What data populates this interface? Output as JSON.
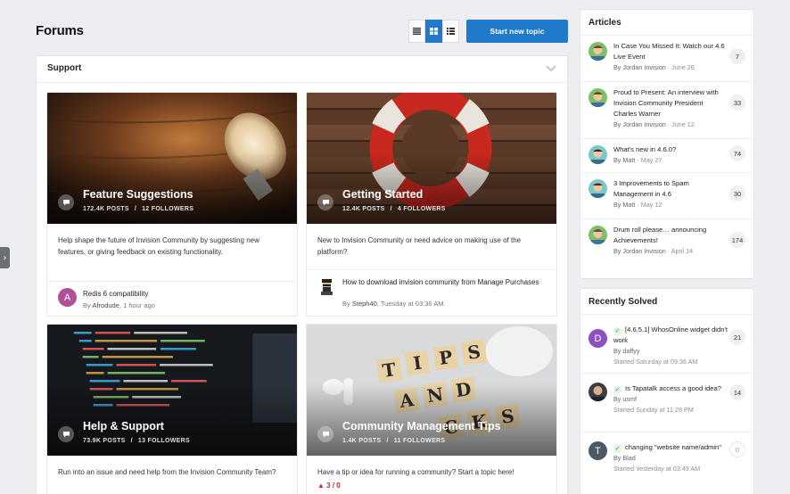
{
  "page": {
    "title": "Forums"
  },
  "toolbar": {
    "start_topic_label": "Start new topic"
  },
  "view_modes": [
    {
      "name": "list-view",
      "icon": "list-icon",
      "active": false
    },
    {
      "name": "grid-view",
      "icon": "grid-icon",
      "active": true
    },
    {
      "name": "table-view",
      "icon": "table-icon",
      "active": false
    }
  ],
  "category": {
    "title": "Support"
  },
  "forums": [
    {
      "title": "Feature Suggestions",
      "posts": "172.4K POSTS",
      "followers": "12 FOLLOWERS",
      "description": "Help shape the future of Invision Community by suggesting new features, or giving feedback on existing functionality.",
      "last_post": {
        "title": "Redis 6 compatibility",
        "by": "By",
        "author": "Afrodude",
        "time": "1 hour ago",
        "avatar_letter": "A",
        "avatar_color": "#b24f9b"
      }
    },
    {
      "title": "Getting Started",
      "posts": "12.4K POSTS",
      "followers": "4 FOLLOWERS",
      "description": "New to Invision Community or need advice on making use of the platform?",
      "last_post": {
        "title": "How to download invision community from Manage Purchases",
        "by": "By",
        "author": "Steph40",
        "time": "Tuesday at 03:36 AM"
      }
    },
    {
      "title": "Help & Support",
      "posts": "73.9K POSTS",
      "followers": "13 FOLLOWERS",
      "description": "Run into an issue and need help from the Invision Community Team?"
    },
    {
      "title": "Community Management Tips",
      "posts": "1.4K POSTS",
      "followers": "11 FOLLOWERS",
      "description": "Have a tip or idea for running a community? Start a topic here!",
      "flag": "3 / 0"
    }
  ],
  "articles": {
    "title": "Articles",
    "items": [
      {
        "title": "In Case You Missed It: Watch our 4.6 Live Event",
        "by": "By",
        "author": "Jordan Invision",
        "date": "June 26",
        "count": "7"
      },
      {
        "title": "Proud to Present: An interview with Invision Community President Charles Warner",
        "by": "By",
        "author": "Jordan Invision",
        "date": "June 12",
        "count": "33"
      },
      {
        "title": "What's new in 4.6.0?",
        "by": "By",
        "author": "Matt",
        "date": "May 27",
        "count": "74"
      },
      {
        "title": "3 Improvements to Spam Management in 4.6",
        "by": "By",
        "author": "Matt",
        "date": "May 12",
        "count": "30"
      },
      {
        "title": "Drum roll please… announcing Achievements!",
        "by": "By",
        "author": "Jordan Invision",
        "date": "April 14",
        "count": "174"
      }
    ]
  },
  "solved": {
    "title": "Recently Solved",
    "items": [
      {
        "title": "[4.6.5.1] WhosOnline widget didn't work",
        "by": "By",
        "author": "daffyy",
        "started": "Started Saturday at 09:36 AM",
        "count": "21",
        "avatar_letter": "D",
        "avatar_color": "#8e4fc2"
      },
      {
        "title": "Is Tapatalk access a good idea?",
        "by": "By",
        "author": "usmf",
        "started": "Started Sunday at 11:28 PM",
        "count": "14"
      },
      {
        "title": "changing \"website name/admin\"",
        "by": "By",
        "author": "Blad",
        "started": "Started Yesterday at 03:49 AM",
        "count": "0",
        "avatar_letter": "T",
        "avatar_color": "#4a5a66"
      }
    ]
  }
}
